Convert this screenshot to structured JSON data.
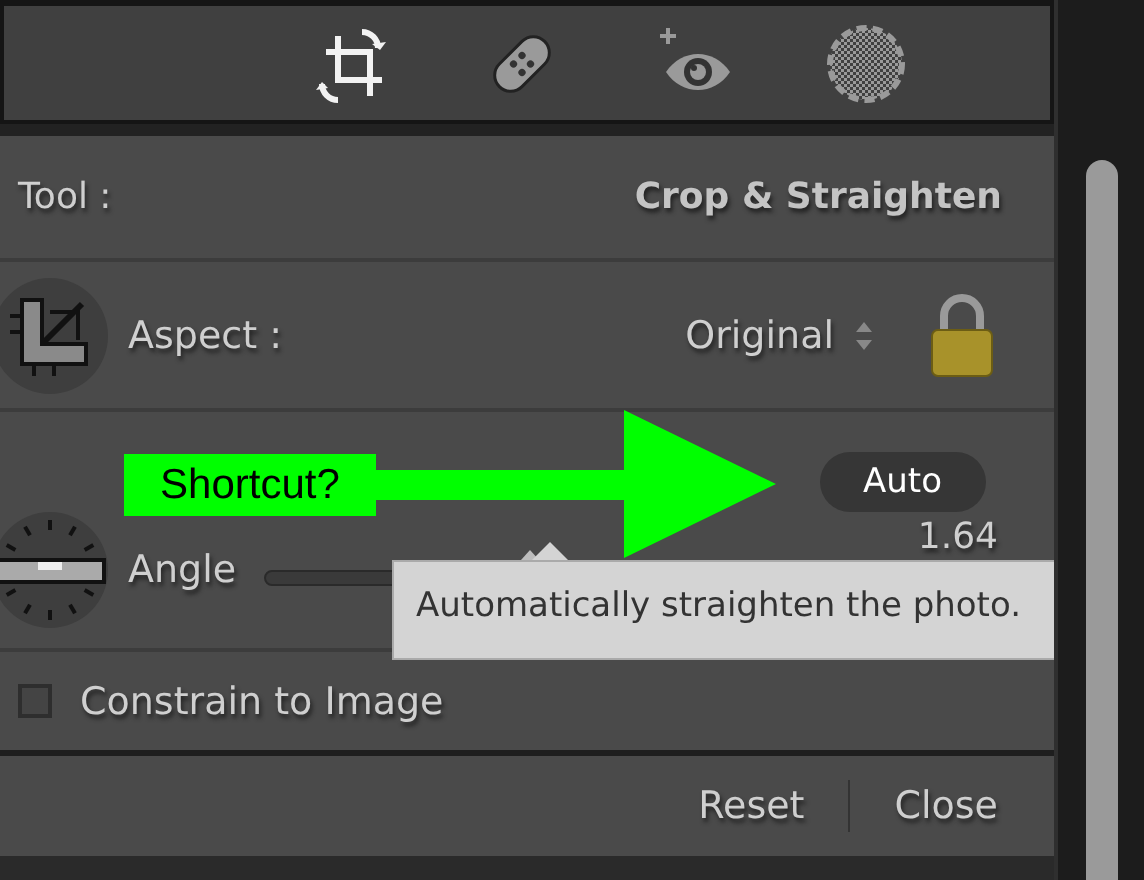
{
  "tools": [
    {
      "kind": "crop",
      "selected": true
    },
    {
      "kind": "heal",
      "selected": false
    },
    {
      "kind": "redeye",
      "selected": false
    },
    {
      "kind": "mask",
      "selected": false
    }
  ],
  "tool_row": {
    "label": "Tool :",
    "value": "Crop & Straighten"
  },
  "aspect": {
    "label": "Aspect :",
    "value": "Original",
    "locked": true
  },
  "auto_button": "Auto",
  "angle": {
    "label": "Angle",
    "level": 0.52,
    "reading": "1.64"
  },
  "tooltip": "Automatically straighten the photo.",
  "constrain": {
    "label": "Constrain to Image",
    "checked": false
  },
  "footer": {
    "buttons": [
      "Reset",
      "Close"
    ]
  },
  "annotation": {
    "text": "Shortcut?"
  }
}
